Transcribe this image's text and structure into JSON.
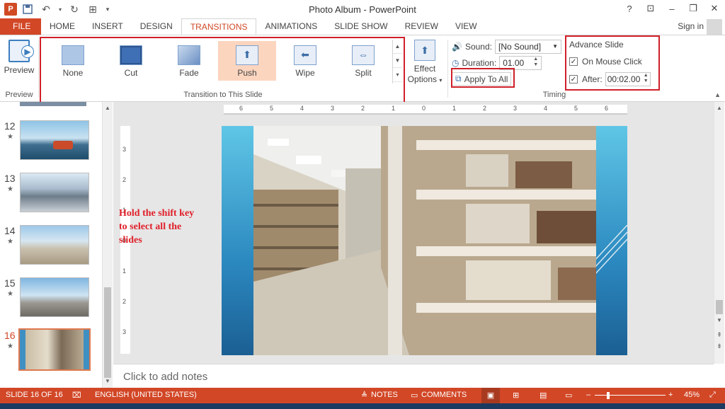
{
  "window": {
    "title": "Photo Album - PowerPoint",
    "controls": [
      "?",
      "⊡",
      "–",
      "❐",
      "✕"
    ]
  },
  "quick_access": {
    "logo": "P"
  },
  "tabs": [
    "FILE",
    "HOME",
    "INSERT",
    "DESIGN",
    "TRANSITIONS",
    "ANIMATIONS",
    "SLIDE SHOW",
    "REVIEW",
    "VIEW"
  ],
  "active_tab": "TRANSITIONS",
  "account": {
    "signin_label": "Sign in"
  },
  "ribbon": {
    "preview": {
      "button_label": "Preview",
      "group_label": "Preview"
    },
    "transitions": {
      "group_label": "Transition to This Slide",
      "items": [
        {
          "label": "None"
        },
        {
          "label": "Cut"
        },
        {
          "label": "Fade"
        },
        {
          "label": "Push",
          "selected": true
        },
        {
          "label": "Wipe"
        },
        {
          "label": "Split"
        }
      ],
      "effect_options_line1": "Effect",
      "effect_options_line2": "Options"
    },
    "timing": {
      "group_label": "Timing",
      "sound_label": "Sound:",
      "sound_value": "[No Sound]",
      "duration_label": "Duration:",
      "duration_value": "01.00",
      "apply_all_label": "Apply To All",
      "advance_title": "Advance Slide",
      "on_mouse_click_label": "On Mouse Click",
      "on_mouse_click_checked": true,
      "after_label": "After:",
      "after_checked": true,
      "after_value": "00:02.00"
    }
  },
  "thumbnails": [
    {
      "number": "12",
      "star": "★"
    },
    {
      "number": "13",
      "star": "★"
    },
    {
      "number": "14",
      "star": "★"
    },
    {
      "number": "15",
      "star": "★"
    },
    {
      "number": "16",
      "star": "★",
      "current": true
    }
  ],
  "ruler": {
    "horizontal_ticks": [
      "6",
      "5",
      "4",
      "3",
      "2",
      "1",
      "0",
      "1",
      "2",
      "3",
      "4",
      "5",
      "6"
    ],
    "vertical_ticks": [
      "3",
      "2",
      "1",
      "0",
      "1",
      "2",
      "3"
    ]
  },
  "annotation": {
    "line1": "Hold the shift key",
    "line2": "to select all the",
    "line3": "slides"
  },
  "notes": {
    "placeholder": "Click to add notes"
  },
  "status": {
    "slide_info": "SLIDE 16 OF 16",
    "language": "ENGLISH (UNITED STATES)",
    "notes_label": "NOTES",
    "comments_label": "COMMENTS",
    "zoom": "45%",
    "minus": "–",
    "plus": "+"
  },
  "colors": {
    "accent": "#d24726",
    "highlight_box": "#d0202a",
    "selected_transition": "#fcd5bf"
  }
}
